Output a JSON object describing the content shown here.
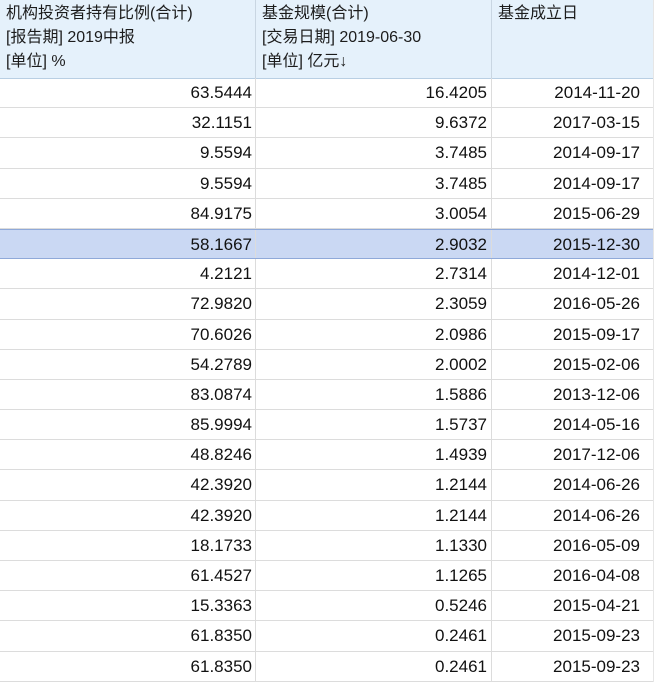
{
  "columns": [
    {
      "title": "机构投资者持有比例(合计)",
      "param": "[报告期] 2019中报",
      "unit": "[单位] %"
    },
    {
      "title": "基金规模(合计)",
      "param": "[交易日期] 2019-06-30",
      "unit": "[单位] 亿元↓"
    },
    {
      "title": "基金成立日",
      "param": "",
      "unit": ""
    }
  ],
  "selected_row": 5,
  "rows": [
    [
      "63.5444",
      "16.4205",
      "2014-11-20"
    ],
    [
      "32.1151",
      "9.6372",
      "2017-03-15"
    ],
    [
      "9.5594",
      "3.7485",
      "2014-09-17"
    ],
    [
      "9.5594",
      "3.7485",
      "2014-09-17"
    ],
    [
      "84.9175",
      "3.0054",
      "2015-06-29"
    ],
    [
      "58.1667",
      "2.9032",
      "2015-12-30"
    ],
    [
      "4.2121",
      "2.7314",
      "2014-12-01"
    ],
    [
      "72.9820",
      "2.3059",
      "2016-05-26"
    ],
    [
      "70.6026",
      "2.0986",
      "2015-09-17"
    ],
    [
      "54.2789",
      "2.0002",
      "2015-02-06"
    ],
    [
      "83.0874",
      "1.5886",
      "2013-12-06"
    ],
    [
      "85.9994",
      "1.5737",
      "2014-05-16"
    ],
    [
      "48.8246",
      "1.4939",
      "2017-12-06"
    ],
    [
      "42.3920",
      "1.2144",
      "2014-06-26"
    ],
    [
      "42.3920",
      "1.2144",
      "2014-06-26"
    ],
    [
      "18.1733",
      "1.1330",
      "2016-05-09"
    ],
    [
      "61.4527",
      "1.1265",
      "2016-04-08"
    ],
    [
      "15.3363",
      "0.5246",
      "2015-04-21"
    ],
    [
      "61.8350",
      "0.2461",
      "2015-09-23"
    ],
    [
      "61.8350",
      "0.2461",
      "2015-09-23"
    ]
  ]
}
